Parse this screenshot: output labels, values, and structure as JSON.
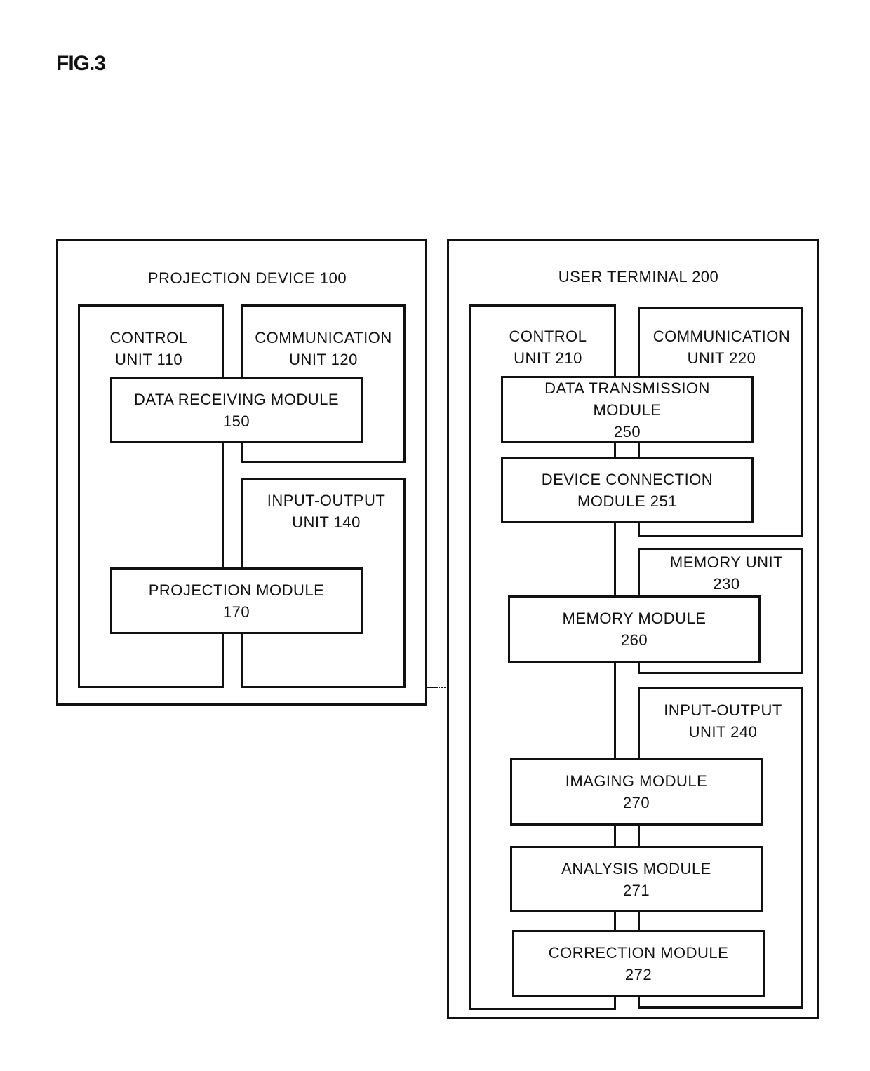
{
  "figure_label": "FIG.3",
  "projection_device": {
    "title": "PROJECTION DEVICE 100",
    "control_unit": {
      "line1": "CONTROL",
      "line2": "UNIT 110"
    },
    "communication_unit": {
      "line1": "COMMUNICATION",
      "line2": "UNIT 120"
    },
    "input_output_unit": {
      "line1": "INPUT-OUTPUT",
      "line2": "UNIT 140"
    },
    "modules": {
      "data_receiving": {
        "line1": "DATA RECEIVING MODULE",
        "line2": "150"
      },
      "projection": {
        "line1": "PROJECTION MODULE",
        "line2": "170"
      }
    }
  },
  "user_terminal": {
    "title": "USER TERMINAL 200",
    "control_unit": {
      "line1": "CONTROL",
      "line2": "UNIT 210"
    },
    "communication_unit": {
      "line1": "COMMUNICATION",
      "line2": "UNIT 220"
    },
    "memory_unit": {
      "line1": "MEMORY UNIT",
      "line2": "230"
    },
    "input_output_unit": {
      "line1": "INPUT-OUTPUT",
      "line2": "UNIT 240"
    },
    "modules": {
      "data_transmission": {
        "line1": "DATA TRANSMISSION",
        "line2": "MODULE",
        "line3": "250"
      },
      "device_connection": {
        "line1": "DEVICE CONNECTION",
        "line2": "MODULE 251"
      },
      "memory": {
        "line1": "MEMORY MODULE",
        "line2": "260"
      },
      "imaging": {
        "line1": "IMAGING MODULE",
        "line2": "270"
      },
      "analysis": {
        "line1": "ANALYSIS MODULE",
        "line2": "271"
      },
      "correction": {
        "line1": "CORRECTION MODULE",
        "line2": "272"
      }
    }
  }
}
